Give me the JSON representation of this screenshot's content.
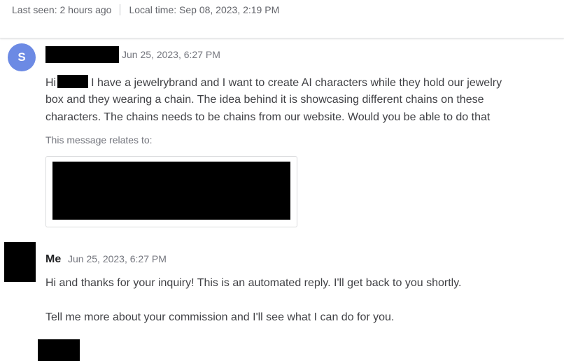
{
  "header": {
    "last_seen": "Last seen: 2 hours ago",
    "local_time": "Local time: Sep 08, 2023, 2:19 PM"
  },
  "messages": [
    {
      "avatar_letter": "S",
      "avatar_color": "#6c8ae4",
      "timestamp": "Jun 25, 2023, 6:27 PM",
      "greeting": "Hi",
      "line1": "I have a jewelrybrand and I want to create AI characters while they hold our jewelry",
      "line2": "box and they wearing a chain. The idea behind it is showcasing different chains on these",
      "line3": "characters. The chains needs to be chains from our website. Would you be able to do that",
      "relates_label": "This message relates to:"
    },
    {
      "sender": "Me",
      "timestamp": "Jun 25, 2023, 6:27 PM",
      "line1": "Hi and thanks for your inquiry! This is an automated reply. I'll get back to you shortly.",
      "line2": "Tell me more about your commission and I'll see what I can do for you."
    }
  ]
}
